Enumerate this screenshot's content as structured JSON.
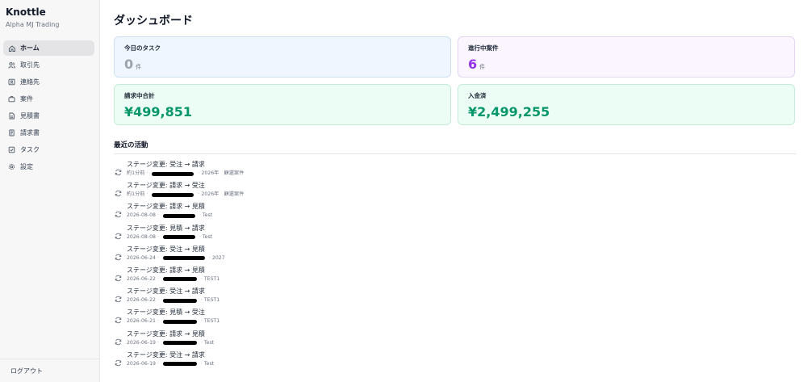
{
  "brand": {
    "name": "Knottle",
    "subtitle": "Alpha MJ Trading"
  },
  "sidebar": {
    "items": [
      {
        "label": "ホーム",
        "icon": "home-icon",
        "active": true
      },
      {
        "label": "取引先",
        "icon": "users-icon",
        "active": false
      },
      {
        "label": "連絡先",
        "icon": "contact-card-icon",
        "active": false
      },
      {
        "label": "案件",
        "icon": "briefcase-icon",
        "active": false
      },
      {
        "label": "見積書",
        "icon": "document-icon",
        "active": false
      },
      {
        "label": "請求書",
        "icon": "invoice-icon",
        "active": false
      },
      {
        "label": "タスク",
        "icon": "checkbox-icon",
        "active": false
      },
      {
        "label": "設定",
        "icon": "gear-icon",
        "active": false
      }
    ],
    "logout_label": "ログアウト"
  },
  "main": {
    "title": "ダッシュボード",
    "cards": [
      {
        "label": "今日のタスク",
        "value": "0",
        "unit": "件",
        "color": "#9ca3af"
      },
      {
        "label": "進行中案件",
        "value": "6",
        "unit": "件",
        "color": "#9333ea"
      },
      {
        "label": "請求中合計",
        "value": "¥499,851",
        "unit": "",
        "color": "#059669"
      },
      {
        "label": "入金済",
        "value": "¥2,499,255",
        "unit": "",
        "color": "#059669"
      }
    ],
    "activity_title": "最近の活動",
    "activities": [
      {
        "title": "ステージ変更: 受注 → 請求",
        "time": "約1分前",
        "tail": "2026年　顧還案件",
        "redact_w": 52
      },
      {
        "title": "ステージ変更: 請求 → 受注",
        "time": "約1分前",
        "tail": "2026年　顧還案件",
        "redact_w": 52
      },
      {
        "title": "ステージ変更: 請求 → 見積",
        "time": "2026-08-08",
        "tail": "Test",
        "redact_w": 40
      },
      {
        "title": "ステージ変更: 見積 → 請求",
        "time": "2026-08-08",
        "tail": "Test",
        "redact_w": 40
      },
      {
        "title": "ステージ変更: 受注 → 見積",
        "time": "2026-06-24",
        "tail": "2027",
        "redact_w": 52
      },
      {
        "title": "ステージ変更: 請求 → 見積",
        "time": "2026-06-22",
        "tail": "TEST1",
        "redact_w": 42
      },
      {
        "title": "ステージ変更: 受注 → 請求",
        "time": "2026-06-22",
        "tail": "TEST1",
        "redact_w": 42
      },
      {
        "title": "ステージ変更: 見積 → 受注",
        "time": "2026-06-21",
        "tail": "TEST1",
        "redact_w": 42
      },
      {
        "title": "ステージ変更: 請求 → 見積",
        "time": "2026-06-19",
        "tail": "Test",
        "redact_w": 42
      },
      {
        "title": "ステージ変更: 受注 → 請求",
        "time": "2026-06-19",
        "tail": "Test",
        "redact_w": 42
      }
    ]
  }
}
